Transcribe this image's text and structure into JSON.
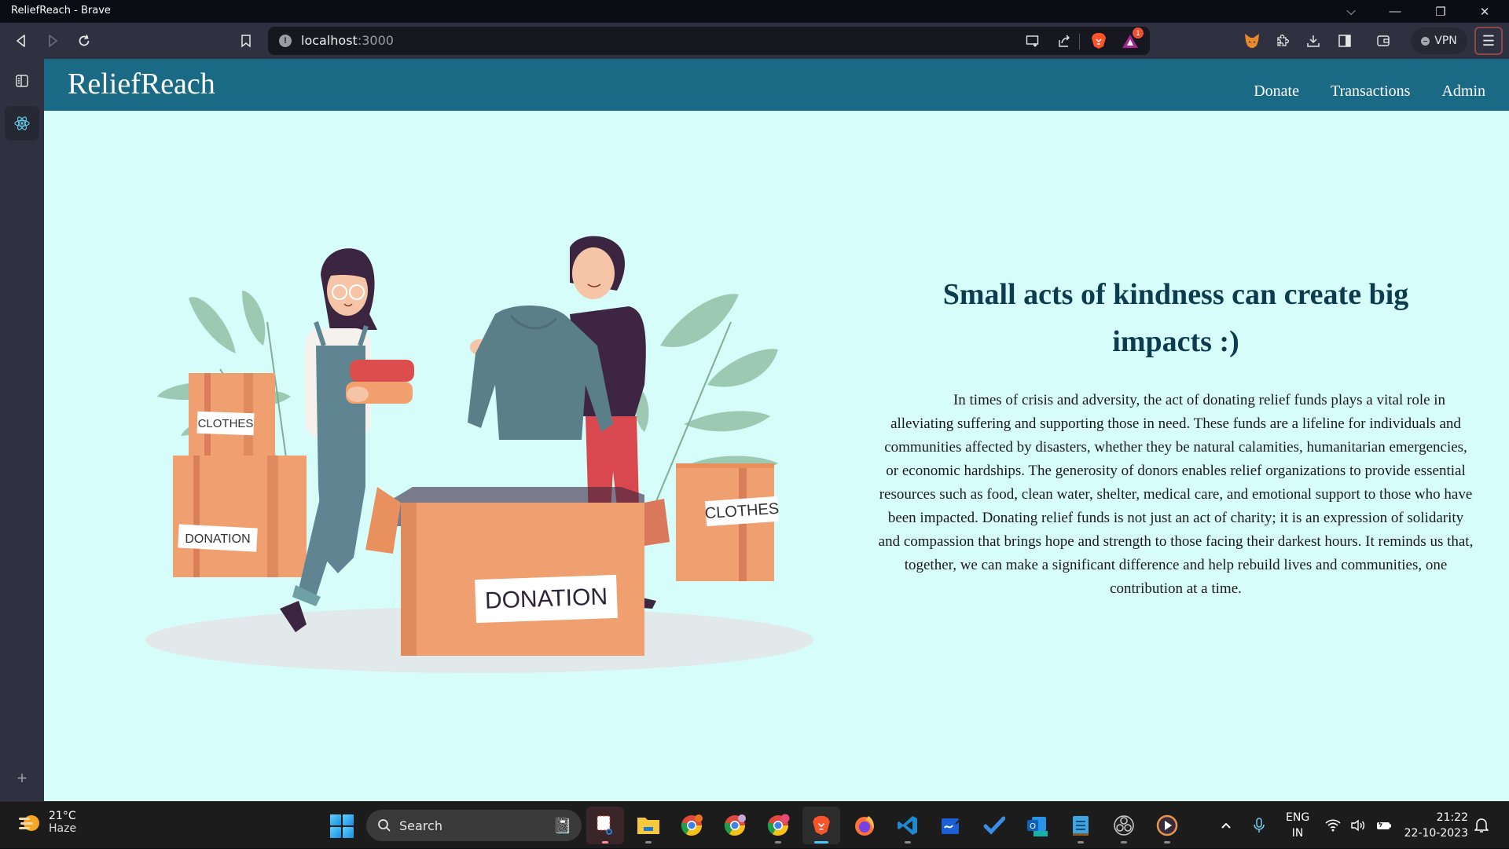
{
  "window": {
    "title": "ReliefReach - Brave",
    "controls": [
      "chevron-down",
      "minimize",
      "restore",
      "close"
    ]
  },
  "browser": {
    "url_host": "localhost",
    "url_port": ":3000",
    "notification_count": "1",
    "vpn_label": "VPN"
  },
  "site": {
    "brand": "ReliefReach",
    "nav": [
      {
        "label": "Donate"
      },
      {
        "label": "Transactions"
      },
      {
        "label": "Admin"
      }
    ],
    "colors": {
      "header": "#1a6a86",
      "background": "#d7fdfb",
      "heading": "#0c3c4f"
    }
  },
  "hero": {
    "heading": "Small acts of kindness can create big impacts :)",
    "body": "In times of crisis and adversity, the act of donating relief funds plays a vital role in alleviating suffering and supporting those in need. These funds are a lifeline for individuals and communities affected by disasters, whether they be natural calamities, humanitarian emergencies, or economic hardships. The generosity of donors enables relief organizations to provide essential resources such as food, clean water, shelter, medical care, and emotional support to those who have been impacted. Donating relief funds is not just an act of charity; it is an expression of solidarity and compassion that brings hope and strength to those facing their darkest hours. It reminds us that, together, we can make a significant difference and help rebuild lives and communities, one contribution at a time."
  },
  "illustration": {
    "box_labels": {
      "top_left": "CLOTHES",
      "bottom_left": "DONATION",
      "center": "DONATION",
      "right": "CLOTHES"
    }
  },
  "taskbar": {
    "weather_temp": "21°C",
    "weather_cond": "Haze",
    "search_label": "Search",
    "lang_top": "ENG",
    "lang_bottom": "IN",
    "time": "21:22",
    "date": "22-10-2023",
    "apps": [
      "snipping-tool",
      "file-explorer",
      "chrome-profile-1",
      "chrome-profile-2",
      "chrome-profile-3",
      "brave",
      "firefox",
      "vscode",
      "whiteboard",
      "todo",
      "outlook-new",
      "notepad",
      "obs",
      "media-player"
    ]
  }
}
